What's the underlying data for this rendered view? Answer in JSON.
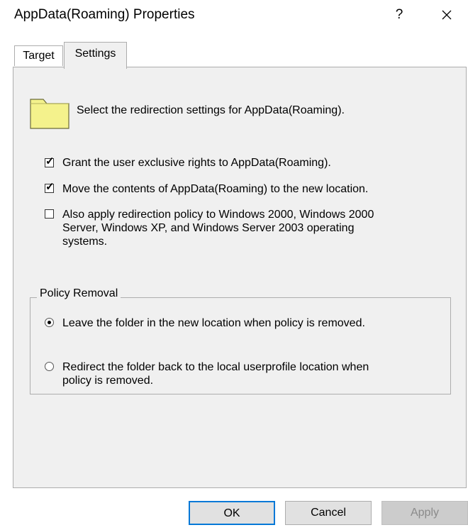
{
  "dialog": {
    "title": "AppData(Roaming) Properties",
    "help_label": "?",
    "close_label": "✕"
  },
  "tabs": [
    {
      "label": "Target",
      "selected": false
    },
    {
      "label": "Settings",
      "selected": true
    }
  ],
  "settings": {
    "folder_icon": "folder-icon",
    "description": "Select the redirection settings for AppData(Roaming).",
    "options": [
      {
        "label": "Grant the user exclusive rights to AppData(Roaming).",
        "checked": true
      },
      {
        "label": "Move the contents of AppData(Roaming) to the new location.",
        "checked": true
      },
      {
        "line1": "Also apply redirection policy to Windows 2000, Windows 2000",
        "line2": "Server, Windows XP, and Windows Server 2003 operating",
        "line3": "systems.",
        "checked": false
      }
    ]
  },
  "policy_removal": {
    "legend": "Policy Removal",
    "options": [
      {
        "label": "Leave the folder in the new location when policy is removed.",
        "selected": true
      },
      {
        "line1": "Redirect the folder back to the local userprofile location when",
        "line2": "policy is removed.",
        "selected": false
      }
    ]
  },
  "buttons": {
    "ok": "OK",
    "cancel": "Cancel",
    "apply": "Apply"
  },
  "colors": {
    "panel_bg": "#f0f0f0",
    "folder_fill": "#f4f28c",
    "ok_border": "#0078d7",
    "disabled_text": "#8a8a8a"
  }
}
